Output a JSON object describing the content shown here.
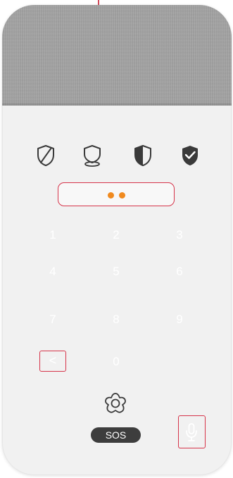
{
  "security_modes": [
    {
      "name": "disarmed",
      "icon": "shield-slash-icon"
    },
    {
      "name": "home-armed",
      "icon": "shield-location-icon"
    },
    {
      "name": "partial-armed",
      "icon": "shield-half-icon"
    },
    {
      "name": "fully-armed",
      "icon": "shield-check-icon"
    }
  ],
  "code_display": {
    "entered_digits": 2
  },
  "keypad": {
    "keys": [
      "1",
      "2",
      "3",
      "4",
      "5",
      "6",
      "7",
      "8",
      "9",
      "0"
    ],
    "backspace_label": "<"
  },
  "sos": {
    "label": "SOS",
    "icon": "flower-sos-icon"
  },
  "mic": {
    "icon": "microphone-icon"
  },
  "colors": {
    "accent_border": "#d6344a",
    "code_dot": "#f08a1f",
    "fabric": "#a5a5a5",
    "panel": "#f1f1f1",
    "sos_pill": "#3d3d3d"
  }
}
